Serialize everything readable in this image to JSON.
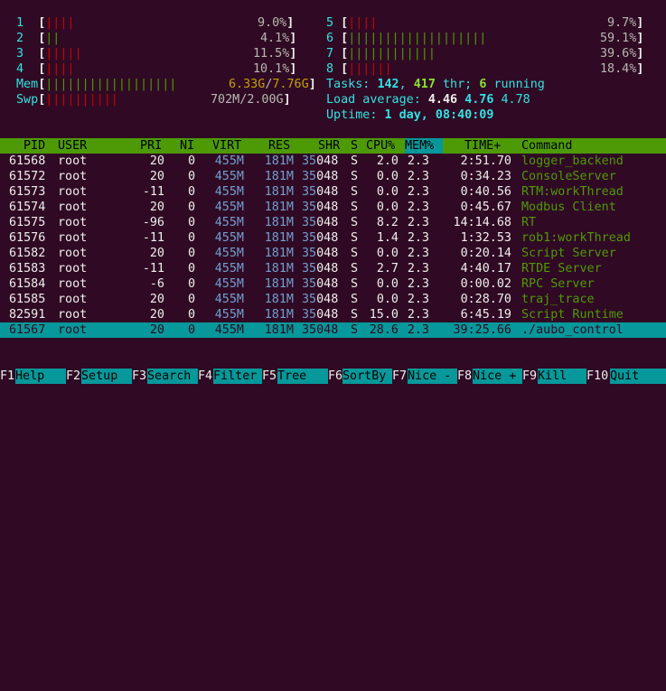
{
  "cpus_left": [
    {
      "id": "1",
      "bars": "||||",
      "pct": "9.0%"
    },
    {
      "id": "2",
      "bars": "||",
      "pct": "4.1%"
    },
    {
      "id": "3",
      "bars": "|||||",
      "pct": "11.5%"
    },
    {
      "id": "4",
      "bars": "||||",
      "pct": "10.1%"
    }
  ],
  "cpus_right": [
    {
      "id": "5",
      "bars": "||||",
      "pct": "9.7%"
    },
    {
      "id": "6",
      "bars": "|||||||||||||||||||",
      "pct": "59.1%"
    },
    {
      "id": "7",
      "bars": "||||||||||||",
      "pct": "39.6%"
    },
    {
      "id": "8",
      "bars": "||||||",
      "pct": "18.4%"
    }
  ],
  "mem": {
    "label": "Mem",
    "bars": "||||||||||||||||||",
    "used": "6.33G",
    "total": "7.76G"
  },
  "swp": {
    "label": "Swp",
    "bars": "||||||||||",
    "used": "702M",
    "total": "2.00G"
  },
  "tasks": {
    "label": "Tasks:",
    "count": "142",
    "thr": "417",
    "thr_label": "thr;",
    "running": "6",
    "running_label": "running"
  },
  "load": {
    "label": "Load average:",
    "l1": "4.46",
    "l5": "4.76",
    "l15": "4.78"
  },
  "uptime": {
    "label": "Uptime:",
    "value": "1 day, 08:40:09"
  },
  "columns": [
    "PID",
    "USER",
    "PRI",
    "NI",
    "VIRT",
    "RES",
    "SHR",
    "S",
    "CPU%",
    "MEM%",
    "TIME+",
    "Command"
  ],
  "processes": [
    {
      "pid": "61568",
      "user": "root",
      "pri": "20",
      "ni": "0",
      "virt": "455M",
      "res": "181M",
      "shr": "35048",
      "s": "S",
      "cpu": "2.0",
      "mem": "2.3",
      "time": "2:51.70",
      "cmd": "logger_backend"
    },
    {
      "pid": "61572",
      "user": "root",
      "pri": "20",
      "ni": "0",
      "virt": "455M",
      "res": "181M",
      "shr": "35048",
      "s": "S",
      "cpu": "0.0",
      "mem": "2.3",
      "time": "0:34.23",
      "cmd": "ConsoleServer"
    },
    {
      "pid": "61573",
      "user": "root",
      "pri": "-11",
      "ni": "0",
      "virt": "455M",
      "res": "181M",
      "shr": "35048",
      "s": "S",
      "cpu": "0.0",
      "mem": "2.3",
      "time": "0:40.56",
      "cmd": "RTM:workThread"
    },
    {
      "pid": "61574",
      "user": "root",
      "pri": "20",
      "ni": "0",
      "virt": "455M",
      "res": "181M",
      "shr": "35048",
      "s": "S",
      "cpu": "0.0",
      "mem": "2.3",
      "time": "0:45.67",
      "cmd": "Modbus Client"
    },
    {
      "pid": "61575",
      "user": "root",
      "pri": "-96",
      "ni": "0",
      "virt": "455M",
      "res": "181M",
      "shr": "35048",
      "s": "S",
      "cpu": "8.2",
      "mem": "2.3",
      "time": "14:14.68",
      "cmd": "RT"
    },
    {
      "pid": "61576",
      "user": "root",
      "pri": "-11",
      "ni": "0",
      "virt": "455M",
      "res": "181M",
      "shr": "35048",
      "s": "S",
      "cpu": "1.4",
      "mem": "2.3",
      "time": "1:32.53",
      "cmd": "rob1:workThread"
    },
    {
      "pid": "61582",
      "user": "root",
      "pri": "20",
      "ni": "0",
      "virt": "455M",
      "res": "181M",
      "shr": "35048",
      "s": "S",
      "cpu": "0.0",
      "mem": "2.3",
      "time": "0:20.14",
      "cmd": "Script Server"
    },
    {
      "pid": "61583",
      "user": "root",
      "pri": "-11",
      "ni": "0",
      "virt": "455M",
      "res": "181M",
      "shr": "35048",
      "s": "S",
      "cpu": "2.7",
      "mem": "2.3",
      "time": "4:40.17",
      "cmd": "RTDE Server"
    },
    {
      "pid": "61584",
      "user": "root",
      "pri": "-6",
      "ni": "0",
      "virt": "455M",
      "res": "181M",
      "shr": "35048",
      "s": "S",
      "cpu": "0.0",
      "mem": "2.3",
      "time": "0:00.02",
      "cmd": "RPC Server"
    },
    {
      "pid": "61585",
      "user": "root",
      "pri": "20",
      "ni": "0",
      "virt": "455M",
      "res": "181M",
      "shr": "35048",
      "s": "S",
      "cpu": "0.0",
      "mem": "2.3",
      "time": "0:28.70",
      "cmd": "traj_trace"
    },
    {
      "pid": "82591",
      "user": "root",
      "pri": "20",
      "ni": "0",
      "virt": "455M",
      "res": "181M",
      "shr": "35048",
      "s": "S",
      "cpu": "15.0",
      "mem": "2.3",
      "time": "6:45.19",
      "cmd": "Script Runtime"
    },
    {
      "pid": "61567",
      "user": "root",
      "pri": "20",
      "ni": "0",
      "virt": "455M",
      "res": "181M",
      "shr": "35048",
      "s": "S",
      "cpu": "28.6",
      "mem": "2.3",
      "time": "39:25.66",
      "cmd": "./aubo_control",
      "selected": true
    }
  ],
  "fkeys": [
    {
      "key": "F1",
      "label": "Help"
    },
    {
      "key": "F2",
      "label": "Setup"
    },
    {
      "key": "F3",
      "label": "Search"
    },
    {
      "key": "F4",
      "label": "Filter"
    },
    {
      "key": "F5",
      "label": "Tree"
    },
    {
      "key": "F6",
      "label": "SortBy"
    },
    {
      "key": "F7",
      "label": "Nice -"
    },
    {
      "key": "F8",
      "label": "Nice +"
    },
    {
      "key": "F9",
      "label": "Kill"
    },
    {
      "key": "F10",
      "label": "Quit"
    }
  ],
  "colors": {
    "background": "#300a24",
    "header": "#4e9a06",
    "selected": "#06989a",
    "cyan": "#34e2e2",
    "green": "#4e9a06",
    "red": "#cc0000"
  }
}
